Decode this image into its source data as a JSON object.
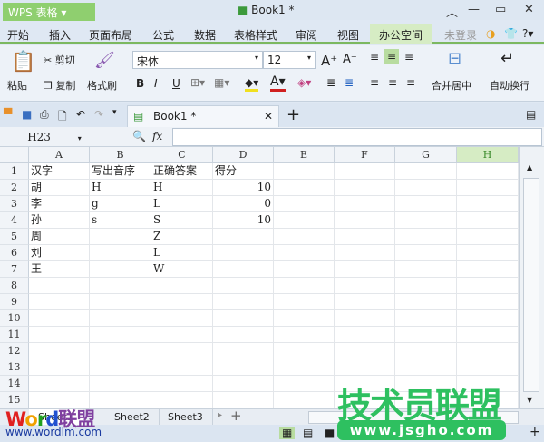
{
  "app": {
    "name": "WPS 表格",
    "doc_title": "Book1 *"
  },
  "menu": [
    "开始",
    "插入",
    "页面布局",
    "公式",
    "数据",
    "表格样式",
    "审阅",
    "视图",
    "办公空间"
  ],
  "account": "未登录",
  "ribbon": {
    "paste": "粘贴",
    "cut": "剪切",
    "copy": "复制",
    "format_painter": "格式刷",
    "font": "宋体",
    "size": "12",
    "bold": "B",
    "italic": "I",
    "underline": "U",
    "merge": "合并居中",
    "wrap": "自动换行"
  },
  "tab": {
    "label": "Book1 *"
  },
  "formula": {
    "cell_ref": "H23",
    "fx": "fx",
    "value": ""
  },
  "columns": [
    "A",
    "B",
    "C",
    "D",
    "E",
    "F",
    "G",
    "H"
  ],
  "selected_column": "H",
  "rows": [
    [
      "汉字",
      "写出音序",
      "正确答案",
      "得分"
    ],
    [
      "胡",
      "H",
      "H",
      "10"
    ],
    [
      "李",
      "g",
      "L",
      "0"
    ],
    [
      "孙",
      "s",
      "S",
      "10"
    ],
    [
      "周",
      "",
      "Z",
      ""
    ],
    [
      "刘",
      "",
      "L",
      ""
    ],
    [
      "王",
      "",
      "W",
      ""
    ],
    [
      "",
      "",
      "",
      ""
    ],
    [
      "",
      "",
      "",
      ""
    ],
    [
      "",
      "",
      "",
      ""
    ],
    [
      "",
      "",
      "",
      ""
    ],
    [
      "",
      "",
      "",
      ""
    ],
    [
      "",
      "",
      "",
      ""
    ],
    [
      "",
      "",
      "",
      ""
    ],
    [
      "",
      "",
      "",
      ""
    ]
  ],
  "sheets": [
    "Sheet1",
    "Sheet2",
    "Sheet3"
  ],
  "watermarks": {
    "left": "Word联盟",
    "left_url": "www.wordlm.com",
    "right": "技术员联盟",
    "right_url": "www.jsgho.com"
  },
  "colors": {
    "accent": "#7cb860",
    "selected_header": "#d6ecc4"
  }
}
